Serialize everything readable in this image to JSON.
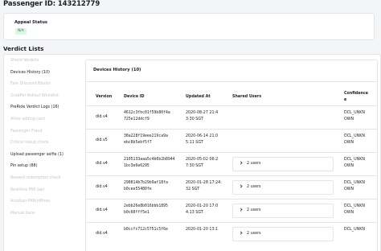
{
  "header": {
    "title": "Passenger ID: 143212779"
  },
  "appeal": {
    "label": "Appeal Status",
    "status": "N/A"
  },
  "verdicts": {
    "title": "Verdict Lists",
    "nav": [
      {
        "label": "Shield Verdicts",
        "enabled": false
      },
      {
        "label": "Devices History (10)",
        "enabled": true
      },
      {
        "label": "Fare Discount Blocks",
        "enabled": false
      },
      {
        "label": "GrabPet Rollout Whitelist",
        "enabled": false
      },
      {
        "label": "PreRide Verdict Logs (16)",
        "enabled": true
      },
      {
        "label": "Allow adding card",
        "enabled": false
      },
      {
        "label": "Passenger Fraud",
        "enabled": false
      },
      {
        "label": "Critical topup check",
        "enabled": false
      },
      {
        "label": "Upload passenger selfie (1)",
        "enabled": true
      },
      {
        "label": "Pin setup (88)",
        "enabled": true
      },
      {
        "label": "Reward redemption check",
        "enabled": false
      },
      {
        "label": "Realtime FAR ban",
        "enabled": false
      },
      {
        "label": "Autoban-FAR(offline)",
        "enabled": false
      },
      {
        "label": "Manual bans",
        "enabled": false
      }
    ]
  },
  "devices": {
    "title": "Devices History (10)",
    "columns": {
      "version": "Version",
      "device_id": "Device ID",
      "updated_at": "Updated At",
      "shared_users": "Shared Users",
      "confidence_1": "Confidence",
      "confidence_2": "e"
    },
    "rows": [
      {
        "version": "did.v4",
        "device_id_1": "4612c3fbc01f59b80f4a",
        "device_id_2": "725e12ddcf9",
        "updated_1": "2020-08-27 21:4",
        "updated_2": "3:30 SGT",
        "shared": "",
        "conf_1": "DCL_UNKN",
        "conf_2": "OWN"
      },
      {
        "version": "did.v5",
        "device_id_1": "38a228f19eee219ca9a",
        "device_id_2": "ebc8b5ebf5f7",
        "updated_1": "2020-06-14 21:0",
        "updated_2": "5:11 SGT",
        "shared": "",
        "conf_1": "DCL_UNKN",
        "conf_2": "OWN"
      },
      {
        "version": "did.v4",
        "device_id_1": "2105133aaa5c4b0b2b8944",
        "device_id_2": "1bc3e6e6295",
        "updated_1": "2020-05-02 06:2",
        "updated_2": "7:30 SGT",
        "shared": "2 users",
        "conf_1": "DCL_UNKN",
        "conf_2": "OWN"
      },
      {
        "version": "did.v4",
        "device_id_1": "298814b7b29b9af18fa",
        "device_id_2": "b0cee55480fe",
        "updated_1": "2020-01-28 17:24:",
        "updated_2": "32 SGT",
        "shared": "2 users",
        "conf_1": "DCL_UNKN",
        "conf_2": "OWN"
      },
      {
        "version": "did.v4",
        "device_id_1": "2ebb26e8b016bbb1895",
        "device_id_2": "b0c60fff5e1",
        "updated_1": "2020-01-20 17:0",
        "updated_2": "4:13 SGT",
        "shared": "2 users",
        "conf_1": "DCL_UNKN",
        "conf_2": "OWN"
      },
      {
        "version": "did.v4",
        "device_id_1": "b0ccfc712c5751c5f6e",
        "device_id_2": "",
        "updated_1": "2020-01-20 13:1",
        "updated_2": "",
        "shared": "2 users",
        "conf_1": "DCL_UNKN",
        "conf_2": ""
      }
    ]
  }
}
